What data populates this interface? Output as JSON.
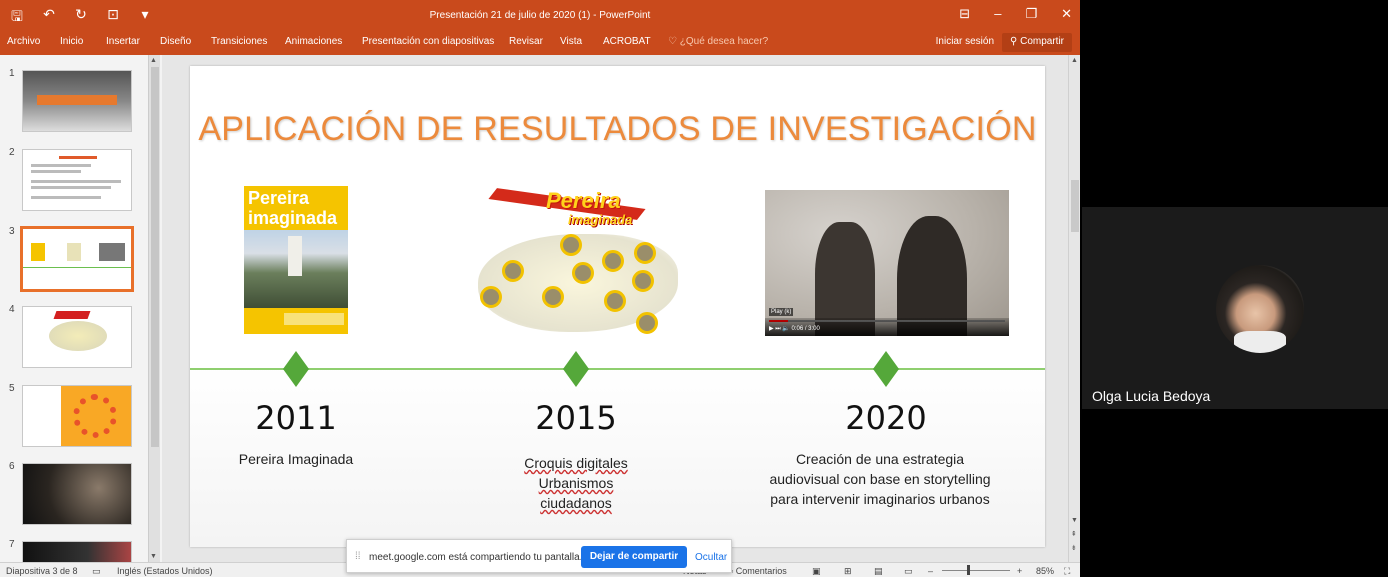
{
  "ppt": {
    "title": "Presentación 21 de julio de 2020 (1) - PowerPoint",
    "tabs": [
      "Archivo",
      "Inicio",
      "Insertar",
      "Diseño",
      "Transiciones",
      "Animaciones",
      "Presentación con diapositivas",
      "Revisar",
      "Vista",
      "ACROBAT"
    ],
    "tell_me": "¿Qué desea hacer?",
    "sign_in": "Iniciar sesión",
    "share": "Compartir",
    "icons": {
      "save": "save-icon",
      "undo": "undo-icon",
      "redo": "redo-icon",
      "present": "present-icon",
      "customize": "customize-qat-icon"
    }
  },
  "thumbnails": [
    "1",
    "2",
    "3",
    "4",
    "5",
    "6",
    "7"
  ],
  "selected_slide": "3",
  "slide": {
    "title": "APLICACIÓN DE RESULTADOS DE INVESTIGACIÓN",
    "book_title_1": "Pereira",
    "book_title_2": "imaginada",
    "map_word_1": "Pereira",
    "map_word_2": "imaginada",
    "video_tooltip": "Play (k)",
    "video_time": "0:06 / 3:00",
    "milestones": [
      {
        "year": "2011",
        "desc_lines": [
          "Pereira Imaginada"
        ]
      },
      {
        "year": "2015",
        "desc_lines": [
          "Croquis digitales",
          "Urbanismos",
          "ciudadanos"
        ]
      },
      {
        "year": "2020",
        "desc_lines": [
          "Creación de una estrategia",
          "audiovisual con base en storytelling",
          "para intervenir imaginarios urbanos"
        ]
      }
    ]
  },
  "status": {
    "slide_counter": "Diapositiva 3 de 8",
    "language": "Inglés (Estados Unidos)",
    "notes": "Notas",
    "comments": "Comentarios",
    "zoom": "85%"
  },
  "share_notice": {
    "message": "meet.google.com está compartiendo tu pantalla.",
    "stop_button": "Dejar de compartir",
    "hide_button": "Ocultar"
  },
  "participant": {
    "name": "Olga Lucia Bedoya"
  }
}
